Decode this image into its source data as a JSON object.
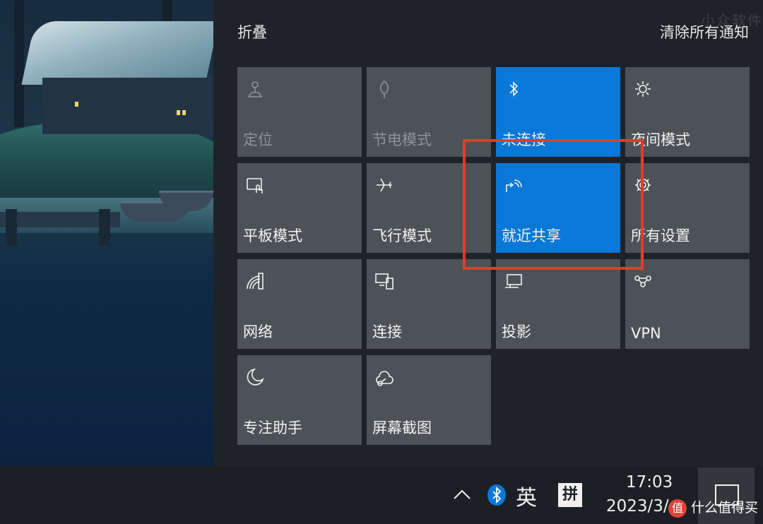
{
  "action_center": {
    "collapse_label": "折叠",
    "clear_all_label": "清除所有通知",
    "tiles": [
      {
        "label": "定位",
        "icon": "location-icon",
        "state": "disabled"
      },
      {
        "label": "节电模式",
        "icon": "battery-saver-icon",
        "state": "disabled"
      },
      {
        "label": "未连接",
        "icon": "bluetooth-icon",
        "state": "on"
      },
      {
        "label": "夜间模式",
        "icon": "night-light-icon",
        "state": "off"
      },
      {
        "label": "平板模式",
        "icon": "tablet-mode-icon",
        "state": "off"
      },
      {
        "label": "飞行模式",
        "icon": "airplane-icon",
        "state": "off"
      },
      {
        "label": "就近共享",
        "icon": "nearby-share-icon",
        "state": "on"
      },
      {
        "label": "所有设置",
        "icon": "gear-icon",
        "state": "off"
      },
      {
        "label": "网络",
        "icon": "network-icon",
        "state": "off"
      },
      {
        "label": "连接",
        "icon": "connect-icon",
        "state": "off"
      },
      {
        "label": "投影",
        "icon": "project-icon",
        "state": "off"
      },
      {
        "label": "VPN",
        "icon": "vpn-icon",
        "state": "off"
      },
      {
        "label": "专注助手",
        "icon": "moon-icon",
        "state": "off"
      },
      {
        "label": "屏幕截图",
        "icon": "screen-snip-icon",
        "state": "off"
      }
    ]
  },
  "taskbar": {
    "ime_language": "英",
    "ime_mode": "拼",
    "clock_time": "17:03",
    "clock_date": "2023/3/"
  },
  "watermarks": {
    "top": "小众软件",
    "bottom_badge": "值",
    "bottom": "什么值得买"
  },
  "colors": {
    "accent": "#0a78d7",
    "tile_off": "#4d5257",
    "panel_bg": "#1f2328",
    "highlight": "#e03d2c"
  }
}
